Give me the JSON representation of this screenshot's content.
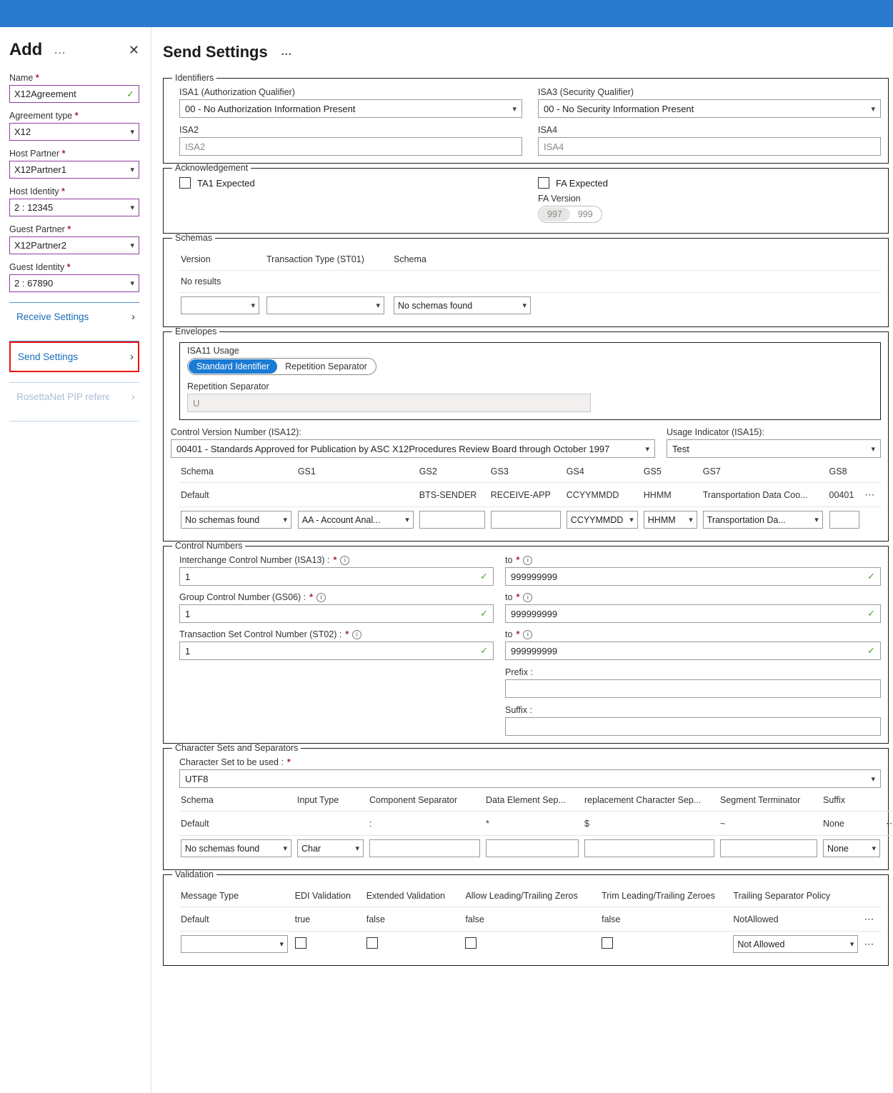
{
  "topbar": {
    "color": "#2a7ad0"
  },
  "left_panel": {
    "title": "Add",
    "menu_icon": "ellipsis-icon",
    "close_icon": "close-icon",
    "fields": [
      {
        "label": "Name",
        "required": true,
        "value": "X12Agreement",
        "kind": "text",
        "valid": true
      },
      {
        "label": "Agreement type",
        "required": true,
        "value": "X12",
        "kind": "select"
      },
      {
        "label": "Host Partner",
        "required": true,
        "value": "X12Partner1",
        "kind": "select"
      },
      {
        "label": "Host Identity",
        "required": true,
        "value": "2 : 12345",
        "kind": "select"
      },
      {
        "label": "Guest Partner",
        "required": true,
        "value": "X12Partner2",
        "kind": "select"
      },
      {
        "label": "Guest Identity",
        "required": true,
        "value": "2 : 67890",
        "kind": "select"
      }
    ],
    "nav": [
      {
        "label": "Receive Settings",
        "selected": false,
        "disabled": false
      },
      {
        "label": "Send Settings",
        "selected": true,
        "disabled": false
      },
      {
        "label": "RosettaNet PIP references",
        "selected": false,
        "disabled": true
      }
    ]
  },
  "main": {
    "title": "Send Settings",
    "menu_icon": "ellipsis-icon",
    "identifiers": {
      "legend": "Identifiers",
      "isa1_label": "ISA1 (Authorization Qualifier)",
      "isa1_value": "00 - No Authorization Information Present",
      "isa3_label": "ISA3 (Security Qualifier)",
      "isa3_value": "00 - No Security Information Present",
      "isa2_label": "ISA2",
      "isa2_placeholder": "ISA2",
      "isa4_label": "ISA4",
      "isa4_placeholder": "ISA4"
    },
    "acknowledgement": {
      "legend": "Acknowledgement",
      "ta1_label": "TA1 Expected",
      "ta1_checked": false,
      "fa_label": "FA Expected",
      "fa_checked": false,
      "fa_version_label": "FA Version",
      "fa_version_options": [
        "997",
        "999"
      ],
      "fa_version_selected": "997"
    },
    "schemas": {
      "legend": "Schemas",
      "columns": [
        "Version",
        "Transaction Type (ST01)",
        "Schema"
      ],
      "empty_text": "No results",
      "inputs": [
        "",
        "",
        "No schemas found"
      ]
    },
    "envelopes": {
      "legend": "Envelopes",
      "isa11_label": "ISA11 Usage",
      "isa11_options": [
        "Standard Identifier",
        "Repetition Separator"
      ],
      "isa11_selected": "Standard Identifier",
      "rep_sep_label": "Repetition Separator",
      "rep_sep_placeholder": "U",
      "isa12_label": "Control Version Number (ISA12):",
      "isa12_value": "00401 - Standards Approved for Publication by ASC X12Procedures Review Board through October 1997",
      "isa15_label": "Usage Indicator (ISA15):",
      "isa15_value": "Test",
      "gs_columns": [
        "Schema",
        "GS1",
        "GS2",
        "GS3",
        "GS4",
        "GS5",
        "GS7",
        "GS8"
      ],
      "gs_default_row": [
        "Default",
        "",
        "BTS-SENDER",
        "RECEIVE-APP",
        "CCYYMMDD",
        "HHMM",
        "Transportation Data Coo...",
        "00401"
      ],
      "gs_input_row": [
        {
          "type": "select",
          "value": "No schemas found"
        },
        {
          "type": "select",
          "value": "AA - Account Anal..."
        },
        {
          "type": "text",
          "value": ""
        },
        {
          "type": "text",
          "value": ""
        },
        {
          "type": "select",
          "value": "CCYYMMDD"
        },
        {
          "type": "select",
          "value": "HHMM"
        },
        {
          "type": "select",
          "value": "Transportation Da..."
        },
        {
          "type": "text",
          "value": ""
        }
      ],
      "row_menu_icon": "ellipsis-icon"
    },
    "control_numbers": {
      "legend": "Control Numbers",
      "rows": [
        {
          "label": "Interchange Control Number (ISA13) :",
          "required": true,
          "from": "1",
          "to_label": "to",
          "to": "999999999"
        },
        {
          "label": "Group Control Number (GS06) :",
          "required": true,
          "from": "1",
          "to_label": "to",
          "to": "999999999"
        },
        {
          "label": "Transaction Set Control Number (ST02) :",
          "required": true,
          "from": "1",
          "to_label": "to",
          "to": "999999999"
        }
      ],
      "prefix_label": "Prefix :",
      "prefix_value": "",
      "suffix_label": "Suffix :",
      "suffix_value": "",
      "info_icon": "info-icon",
      "valid_icon": "checkmark-icon"
    },
    "charsets": {
      "legend": "Character Sets and Separators",
      "charset_label": "Character Set to be used :",
      "charset_required": true,
      "charset_value": "UTF8",
      "columns": [
        "Schema",
        "Input Type",
        "Component Separator",
        "Data Element Sep...",
        "replacement Character Sep...",
        "Segment Terminator",
        "Suffix"
      ],
      "default_row": [
        "Default",
        "",
        ":",
        "*",
        "$",
        "~",
        "None"
      ],
      "input_row": [
        {
          "type": "select",
          "value": "No schemas found"
        },
        {
          "type": "select",
          "value": "Char"
        },
        {
          "type": "text",
          "value": ""
        },
        {
          "type": "text",
          "value": ""
        },
        {
          "type": "text",
          "value": ""
        },
        {
          "type": "text",
          "value": ""
        },
        {
          "type": "select",
          "value": "None"
        }
      ],
      "row_menu_icon": "ellipsis-icon"
    },
    "validation": {
      "legend": "Validation",
      "columns": [
        "Message Type",
        "EDI Validation",
        "Extended Validation",
        "Allow Leading/Trailing Zeros",
        "Trim Leading/Trailing Zeroes",
        "Trailing Separator Policy"
      ],
      "default_row": [
        "Default",
        "true",
        "false",
        "false",
        "false",
        "NotAllowed"
      ],
      "input_row": {
        "message_type": "",
        "edi_validation_checked": false,
        "extended_validation_checked": false,
        "allow_zeros_checked": false,
        "trim_zeros_checked": false,
        "trailing_separator_policy": "Not Allowed"
      },
      "row_menu_icon": "ellipsis-icon"
    }
  }
}
